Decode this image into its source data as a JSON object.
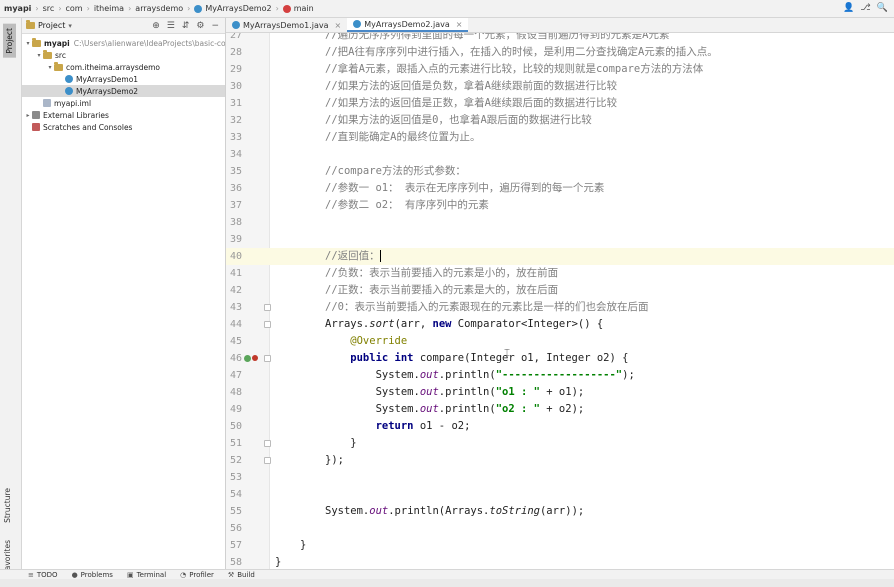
{
  "breadcrumb": [
    "myapi",
    "src",
    "com",
    "itheima",
    "arraysdemo",
    "MyArraysDemo2",
    "main"
  ],
  "project_panel": {
    "title": "Project",
    "tree": [
      {
        "label": "myapi",
        "path": "C:\\Users\\alienware\\IdeaProjects\\basic-code\\myapi",
        "depth": 0,
        "icon": "folder-icon",
        "arrow": "▾"
      },
      {
        "label": "src",
        "depth": 1,
        "icon": "folder-icon",
        "arrow": "▾"
      },
      {
        "label": "com.itheima.arraysdemo",
        "depth": 2,
        "icon": "package-icon",
        "arrow": "▾"
      },
      {
        "label": "MyArraysDemo1",
        "depth": 3,
        "icon": "class-icon",
        "arrow": ""
      },
      {
        "label": "MyArraysDemo2",
        "depth": 3,
        "icon": "class-icon",
        "arrow": "",
        "selected": true
      },
      {
        "label": "myapi.iml",
        "depth": 1,
        "icon": "file-icon",
        "arrow": ""
      },
      {
        "label": "External Libraries",
        "depth": 0,
        "icon": "library-icon",
        "arrow": "▸"
      },
      {
        "label": "Scratches and Consoles",
        "depth": 0,
        "icon": "scratch-icon",
        "arrow": ""
      }
    ]
  },
  "left_strip": {
    "project": "Project",
    "structure": "Structure",
    "favorites": "Favorites"
  },
  "editor_tabs": [
    {
      "label": "MyArraysDemo1.java",
      "active": false
    },
    {
      "label": "MyArraysDemo2.java",
      "active": true
    }
  ],
  "code_lines": [
    {
      "n": "27",
      "text": "//遍历无序序列得到里面的每一个元素，假设当前遍历得到的元素是A元素",
      "kind": "comment"
    },
    {
      "n": "28",
      "text": "//把A往有序序列中进行插入，在插入的时候，是利用二分查找确定A元素的插入点。",
      "kind": "comment"
    },
    {
      "n": "29",
      "text": "//拿着A元素，跟插入点的元素进行比较，比较的规则就是compare方法的方法体",
      "kind": "comment"
    },
    {
      "n": "30",
      "text": "//如果方法的返回值是负数，拿着A继续跟前面的数据进行比较",
      "kind": "comment"
    },
    {
      "n": "31",
      "text": "//如果方法的返回值是正数，拿着A继续跟后面的数据进行比较",
      "kind": "comment"
    },
    {
      "n": "32",
      "text": "//如果方法的返回值是0，也拿着A跟后面的数据进行比较",
      "kind": "comment"
    },
    {
      "n": "33",
      "text": "//直到能确定A的最终位置为止。",
      "kind": "comment"
    },
    {
      "n": "34",
      "text": "",
      "kind": "blank"
    },
    {
      "n": "35",
      "text": "//compare方法的形式参数：",
      "kind": "comment"
    },
    {
      "n": "36",
      "text": "//参数一 o1： 表示在无序序列中，遍历得到的每一个元素",
      "kind": "comment"
    },
    {
      "n": "37",
      "text": "//参数二 o2： 有序序列中的元素",
      "kind": "comment"
    },
    {
      "n": "38",
      "text": "",
      "kind": "blank"
    },
    {
      "n": "39",
      "text": "",
      "kind": "blank"
    },
    {
      "n": "40",
      "text": "//返回值：",
      "kind": "comment",
      "current": true
    },
    {
      "n": "41",
      "text": "//负数：表示当前要插入的元素是小的，放在前面",
      "kind": "comment"
    },
    {
      "n": "42",
      "text": "//正数：表示当前要插入的元素是大的，放在后面",
      "kind": "comment"
    },
    {
      "n": "43",
      "text": "//0：表示当前要插入的元素跟现在的元素比是一样的们也会放在后面",
      "kind": "comment",
      "fold": true
    },
    {
      "n": "44",
      "kind": "code",
      "fold": true,
      "parts": [
        [
          "",
          "Arrays."
        ],
        [
          "sm",
          "sort"
        ],
        [
          "",
          "(arr, "
        ],
        [
          "kw",
          "new"
        ],
        [
          "",
          " Comparator<Integer>() {"
        ]
      ]
    },
    {
      "n": "45",
      "kind": "code",
      "parts": [
        [
          "ann",
          "    @Override"
        ]
      ]
    },
    {
      "n": "46",
      "kind": "code",
      "fold": true,
      "marker": true,
      "parts": [
        [
          "kw",
          "    public int"
        ],
        [
          "",
          " compare(Integer o1, Integer o2) {"
        ]
      ]
    },
    {
      "n": "47",
      "kind": "code",
      "parts": [
        [
          "",
          "        System."
        ],
        [
          "fld",
          "out"
        ],
        [
          "",
          ".println("
        ],
        [
          "str",
          "\"------------------\""
        ],
        [
          "",
          ");"
        ]
      ]
    },
    {
      "n": "48",
      "kind": "code",
      "parts": [
        [
          "",
          "        System."
        ],
        [
          "fld",
          "out"
        ],
        [
          "",
          ".println("
        ],
        [
          "str",
          "\"o1 : \""
        ],
        [
          "",
          " + o1);"
        ]
      ]
    },
    {
      "n": "49",
      "kind": "code",
      "parts": [
        [
          "",
          "        System."
        ],
        [
          "fld",
          "out"
        ],
        [
          "",
          ".println("
        ],
        [
          "str",
          "\"o2 : \""
        ],
        [
          "",
          " + o2);"
        ]
      ]
    },
    {
      "n": "50",
      "kind": "code",
      "parts": [
        [
          "kw",
          "        return"
        ],
        [
          "",
          " o1 - o2;"
        ]
      ]
    },
    {
      "n": "51",
      "kind": "code",
      "fold": true,
      "parts": [
        [
          "",
          "    }"
        ]
      ]
    },
    {
      "n": "52",
      "kind": "code",
      "fold": true,
      "parts": [
        [
          "",
          "});"
        ]
      ]
    },
    {
      "n": "53",
      "text": "",
      "kind": "blank"
    },
    {
      "n": "54",
      "text": "",
      "kind": "blank"
    },
    {
      "n": "55",
      "kind": "code",
      "parts": [
        [
          "",
          "System."
        ],
        [
          "fld",
          "out"
        ],
        [
          "",
          ".println(Arrays."
        ],
        [
          "sm",
          "toString"
        ],
        [
          "",
          "(arr));"
        ]
      ]
    },
    {
      "n": "56",
      "text": "",
      "kind": "blank"
    },
    {
      "n": "57",
      "kind": "code",
      "outdent": 1,
      "parts": [
        [
          "",
          "}"
        ]
      ]
    },
    {
      "n": "58",
      "kind": "code",
      "outdent": 2,
      "parts": [
        [
          "",
          "}"
        ]
      ]
    }
  ],
  "bottom_tabs": [
    {
      "label": "TODO",
      "icon": "≡"
    },
    {
      "label": "Problems",
      "icon": "●"
    },
    {
      "label": "Terminal",
      "icon": "▣"
    },
    {
      "label": "Profiler",
      "icon": "◔"
    },
    {
      "label": "Build",
      "icon": "⚒"
    }
  ],
  "colors": {
    "accent": "#4a88c7",
    "comment": "#808080",
    "keyword": "#000080",
    "string": "#008000",
    "annotation": "#808000"
  }
}
